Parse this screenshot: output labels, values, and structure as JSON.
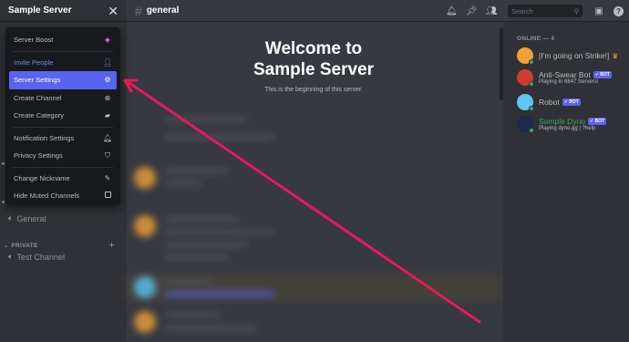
{
  "server": {
    "name": "Sample Server",
    "close_icon": "close-icon"
  },
  "menu": {
    "items": [
      {
        "label": "Server Boost",
        "icon": "boost-icon"
      },
      {
        "label": "Invite People",
        "icon": "add-person-icon"
      },
      {
        "label": "Server Settings",
        "icon": "gear-icon"
      },
      {
        "label": "Create Channel",
        "icon": "plus-circle-icon"
      },
      {
        "label": "Create Category",
        "icon": "folder-plus-icon"
      },
      {
        "label": "Notification Settings",
        "icon": "bell-icon"
      },
      {
        "label": "Privacy Settings",
        "icon": "shield-icon"
      },
      {
        "label": "Change Nickname",
        "icon": "pencil-icon"
      },
      {
        "label": "Hide Muted Channels",
        "icon": "checkbox-icon"
      }
    ]
  },
  "channels": {
    "voice_general": "General",
    "private_category": "PRIVATE",
    "test_channel": "Test Channel"
  },
  "topbar": {
    "channel": "general",
    "search_placeholder": "Search"
  },
  "welcome": {
    "title_line1": "Welcome to",
    "title_line2": "Sample Server",
    "subtitle": "This is the beginning of this server."
  },
  "members": {
    "header": "ONLINE — 4",
    "list": [
      {
        "name": "[I'm going on Strike!]",
        "status": "",
        "bot": false,
        "crown": true
      },
      {
        "name": "Anti-Swear Bot",
        "status": "Playing In 6847 Servers!",
        "bot": true
      },
      {
        "name": "Robot",
        "status": "",
        "bot": true
      },
      {
        "name": "Sample Dyno",
        "status": "Playing dyno.gg | ?help",
        "bot": true
      }
    ],
    "bot_label": "✓ BOT"
  },
  "colors": {
    "accent": "#5865f2",
    "online": "#3ba55d",
    "arrow": "#e8185a"
  }
}
